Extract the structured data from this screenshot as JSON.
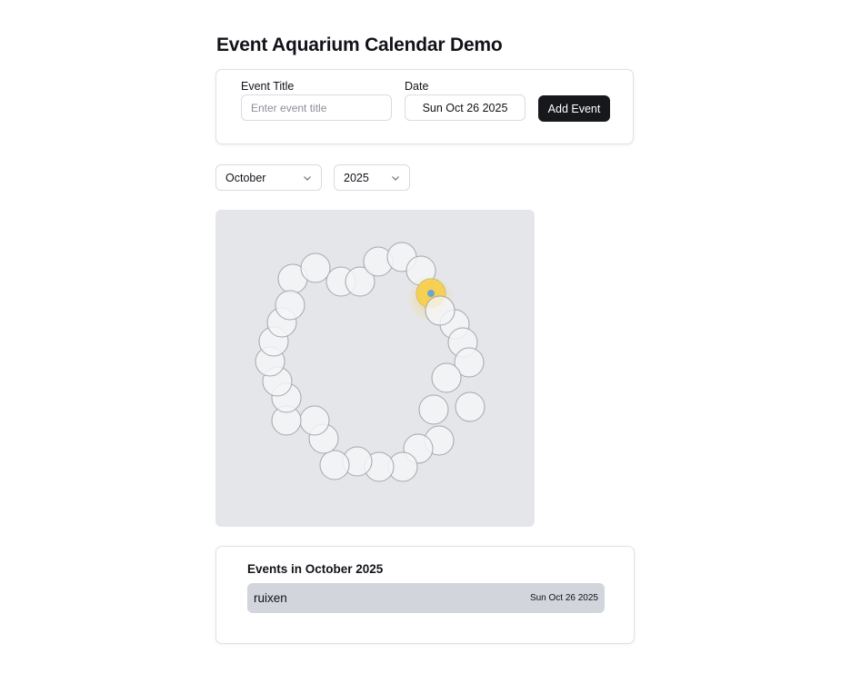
{
  "page": {
    "title": "Event Aquarium Calendar Demo"
  },
  "form": {
    "title_label": "Event Title",
    "title_placeholder": "Enter event title",
    "title_value": "",
    "date_label": "Date",
    "date_value": "Sun Oct 26 2025",
    "add_label": "Add Event"
  },
  "filters": {
    "month": "October",
    "year": "2025"
  },
  "aquarium": {
    "colors": {
      "bubble_fill": "#f3f4f6",
      "bubble_stroke": "#a3a7ae",
      "event_fill": "#f6cd45",
      "event_dot": "#6fa3d8",
      "background": "#e5e6e9"
    },
    "highlighted_day": 26
  },
  "events": {
    "heading": "Events in October 2025",
    "items": [
      {
        "title": "ruixen",
        "date": "Sun Oct 26 2025"
      }
    ]
  }
}
